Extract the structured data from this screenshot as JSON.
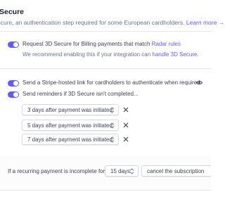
{
  "section": {
    "title": "Secure",
    "description": "ecure, an authentication step required for some European cardholders.",
    "learn_more": "Learn more →"
  },
  "request_3ds": {
    "label": "Request 3D Secure for Billing payments that match",
    "link": "Radar rules",
    "enabled": true,
    "hint_prefix": "We recommend enabling this if your integration can",
    "hint_link": "handle 3D Secure",
    "hint_suffix": "."
  },
  "hosted_link": {
    "label": "Send a Stripe-hosted link for cardholders to authenticate when required",
    "enabled": true,
    "icon": "eye-icon"
  },
  "reminders": {
    "label": "Send reminders if 3D Secure isn't completed...",
    "enabled": true,
    "items": [
      {
        "value": "3 days after payment was initiated"
      },
      {
        "value": "5 days after payment was initiated"
      },
      {
        "value": "7 days after payment was initiated"
      }
    ]
  },
  "recurring": {
    "label": "If a recurring payment is incomplete for",
    "days_value": "15 days",
    "action_value": "cancel the subscription"
  },
  "colors": {
    "accent": "#635bff",
    "text": "#3c4257",
    "muted": "#697386",
    "border": "#d5dbe1"
  }
}
